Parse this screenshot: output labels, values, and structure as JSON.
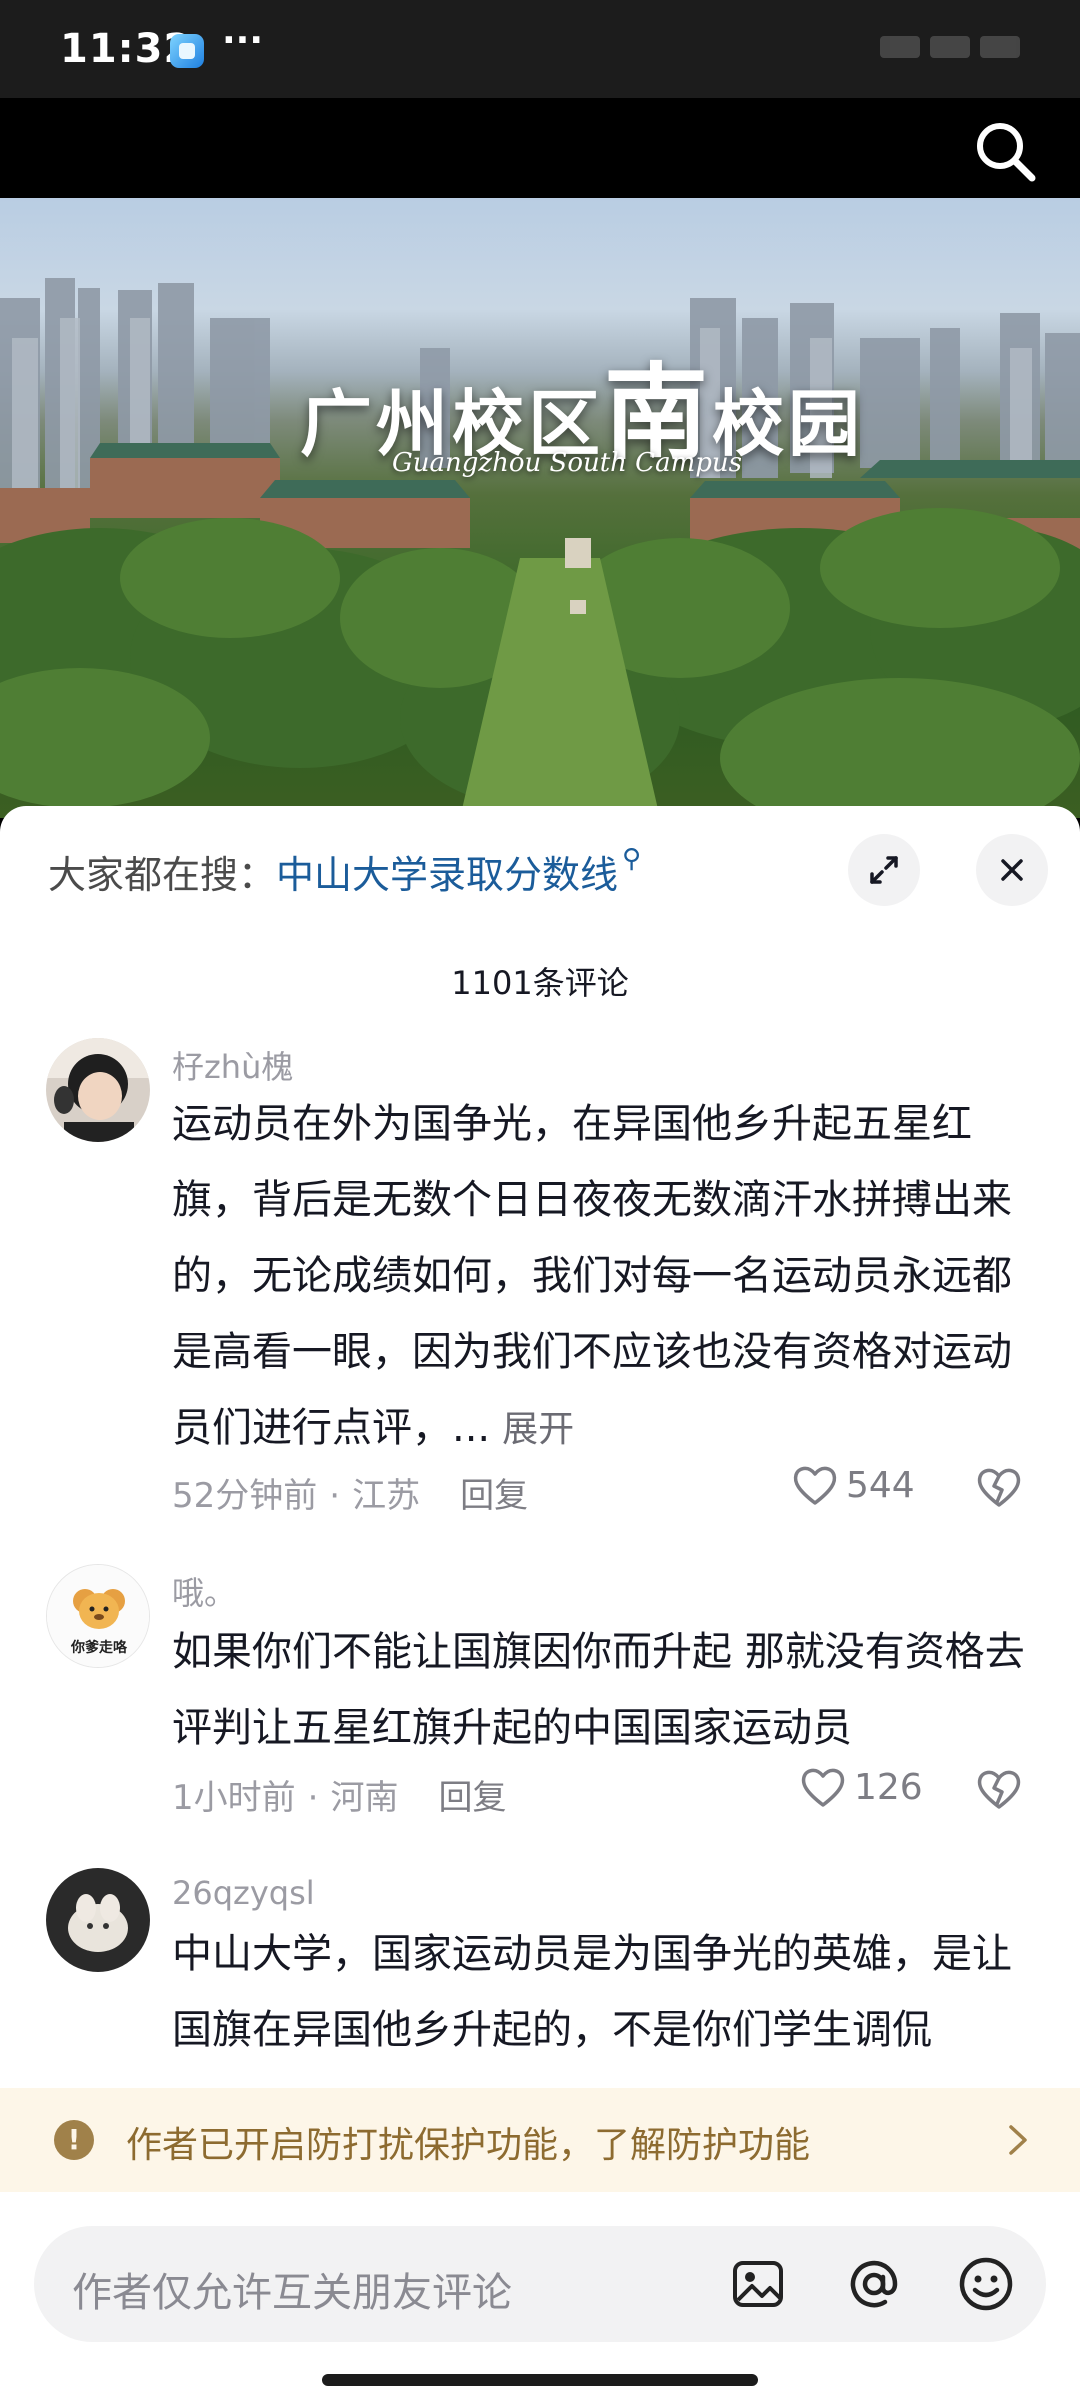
{
  "status_bar": {
    "time": "11:32",
    "more": "···"
  },
  "video": {
    "title_part1": "广州校区",
    "title_big": "南",
    "title_part2": "校园",
    "subtitle": "Guangzhou South Campus"
  },
  "sheet": {
    "search_hint_prefix": "大家都在搜：",
    "search_hint_keyword": "中山大学录取分数线",
    "comment_count": "1101条评论"
  },
  "comments": [
    {
      "user": "杍zhù槐",
      "text": "运动员在外为国争光，在异国他乡升起五星红旗，背后是无数个日日夜夜无数滴汗水拼搏出来的，无论成绩如何，我们对每一名运动员永远都是高看一眼，因为我们不应该也没有资格对运动员们进行点评，...",
      "more": "展开",
      "time": "52分钟前",
      "location": "江苏",
      "reply": "回复",
      "likes": "544",
      "avatar_badge": ""
    },
    {
      "user": "哦。",
      "text": "如果你们不能让国旗因你而升起 那就没有资格去评判让五星红旗升起的中国国家运动员",
      "more": "",
      "time": "1小时前",
      "location": "河南",
      "reply": "回复",
      "likes": "126",
      "avatar_badge": "你爹走咯"
    },
    {
      "user": "26qzyqsl",
      "text": "中山大学，国家运动员是为国争光的英雄，是让国旗在异国他乡升起的，不是你们学生调侃",
      "more": "",
      "time": "",
      "location": "",
      "reply": "",
      "likes": "",
      "avatar_badge": ""
    }
  ],
  "notice": {
    "text": "作者已开启防打扰保护功能，了解防护功能"
  },
  "input": {
    "placeholder": "作者仅允许互关朋友评论"
  },
  "colors": {
    "accent_link": "#1b5c9a",
    "notice_bg": "#fdf6e8",
    "notice_text": "#8d6b30"
  }
}
